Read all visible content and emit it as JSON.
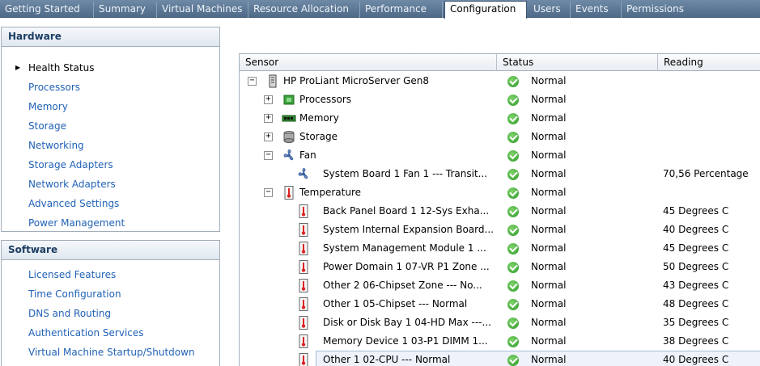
{
  "tabs": [
    {
      "label": "Getting Started",
      "active": false
    },
    {
      "label": "Summary",
      "active": false
    },
    {
      "label": "Virtual Machines",
      "active": false
    },
    {
      "label": "Resource Allocation",
      "active": false
    },
    {
      "label": "Performance",
      "active": false
    },
    {
      "label": "Configuration",
      "active": true
    },
    {
      "label": "Users",
      "active": false
    },
    {
      "label": "Events",
      "active": false
    },
    {
      "label": "Permissions",
      "active": false
    }
  ],
  "hardware": {
    "title": "Hardware",
    "items": [
      "Health Status",
      "Processors",
      "Memory",
      "Storage",
      "Networking",
      "Storage Adapters",
      "Network Adapters",
      "Advanced Settings",
      "Power Management"
    ],
    "current": "Health Status"
  },
  "software": {
    "title": "Software",
    "items": [
      "Licensed Features",
      "Time Configuration",
      "DNS and Routing",
      "Authentication Services",
      "Virtual Machine Startup/Shutdown"
    ]
  },
  "table": {
    "columns": [
      "Sensor",
      "Status",
      "Reading"
    ],
    "rows": [
      {
        "sensor": "HP ProLiant MicroServer Gen8",
        "status": "Normal",
        "reading": "",
        "expander": "−",
        "icon": "server-icon"
      },
      {
        "sensor": "Processors",
        "status": "Normal",
        "reading": "",
        "expander": "+",
        "icon": "processor-icon"
      },
      {
        "sensor": "Memory",
        "status": "Normal",
        "reading": "",
        "expander": "+",
        "icon": "memory-icon"
      },
      {
        "sensor": "Storage",
        "status": "Normal",
        "reading": "",
        "expander": "+",
        "icon": "storage-icon"
      },
      {
        "sensor": "Fan",
        "status": "Normal",
        "reading": "",
        "expander": "−",
        "icon": "fan-icon"
      },
      {
        "sensor": "System Board 1 Fan 1 --- Transit...",
        "status": "Normal",
        "reading": "70,56 Percentage",
        "expander": "",
        "icon": "fan-icon"
      },
      {
        "sensor": "Temperature",
        "status": "Normal",
        "reading": "",
        "expander": "−",
        "icon": "thermometer-icon"
      },
      {
        "sensor": "Back Panel Board 1 12-Sys Exha...",
        "status": "Normal",
        "reading": "45 Degrees C",
        "expander": "",
        "icon": "thermometer-icon"
      },
      {
        "sensor": "System Internal Expansion Board...",
        "status": "Normal",
        "reading": "40 Degrees C",
        "expander": "",
        "icon": "thermometer-icon"
      },
      {
        "sensor": "System Management Module 1 ...",
        "status": "Normal",
        "reading": "45 Degrees C",
        "expander": "",
        "icon": "thermometer-icon"
      },
      {
        "sensor": "Power Domain 1 07-VR P1 Zone ...",
        "status": "Normal",
        "reading": "50 Degrees C",
        "expander": "",
        "icon": "thermometer-icon"
      },
      {
        "sensor": "Other 2 06-Chipset Zone --- No...",
        "status": "Normal",
        "reading": "43 Degrees C",
        "expander": "",
        "icon": "thermometer-icon"
      },
      {
        "sensor": "Other 1 05-Chipset --- Normal",
        "status": "Normal",
        "reading": "48 Degrees C",
        "expander": "",
        "icon": "thermometer-icon"
      },
      {
        "sensor": "Disk or Disk Bay 1 04-HD Max ---...",
        "status": "Normal",
        "reading": "35 Degrees C",
        "expander": "",
        "icon": "thermometer-icon"
      },
      {
        "sensor": "Memory Device 1 03-P1 DIMM 1...",
        "status": "Normal",
        "reading": "38 Degrees C",
        "expander": "",
        "icon": "thermometer-icon"
      },
      {
        "sensor": "Other 1 02-CPU --- Normal",
        "status": "Normal",
        "reading": "40 Degrees C",
        "expander": "",
        "icon": "thermometer-icon",
        "selected": true
      }
    ]
  },
  "colors": {
    "link": "#2162b6",
    "status_ok": "#2f9a2a",
    "tabbar": "#5a7694"
  }
}
